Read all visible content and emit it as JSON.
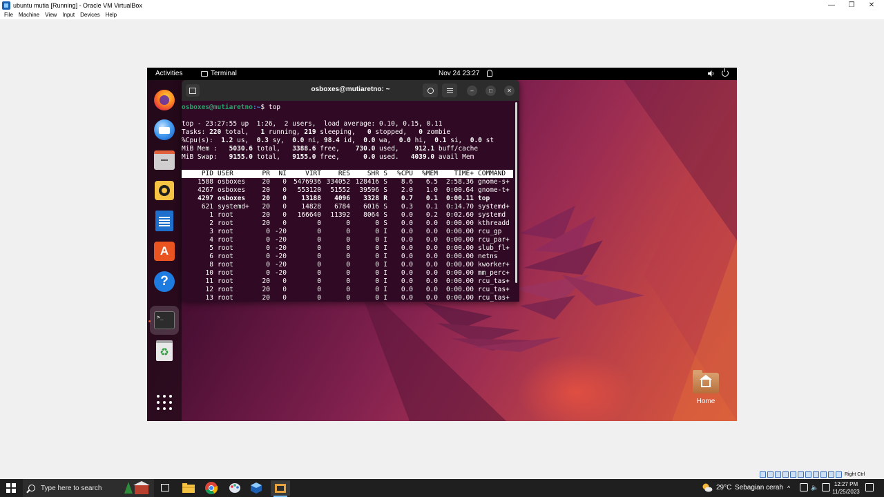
{
  "vbox": {
    "title": "ubuntu mutia [Running] - Oracle VM VirtualBox",
    "menu": [
      "File",
      "Machine",
      "View",
      "Input",
      "Devices",
      "Help"
    ],
    "controls": {
      "minimize": "—",
      "maximize": "❐",
      "close": "✕"
    },
    "host_key": "Right Ctrl"
  },
  "gnome": {
    "activities": "Activities",
    "active_app": "Terminal",
    "clock": "Nov 24  23:27",
    "home_label": "Home"
  },
  "dock": {
    "items": [
      "firefox-icon",
      "thunderbird-icon",
      "files-icon",
      "rhythmbox-icon",
      "libreoffice-writer-icon",
      "ubuntu-software-icon",
      "help-icon",
      "terminal-icon",
      "trash-icon",
      "show-apps-icon"
    ],
    "software_glyph": "A",
    "help_glyph": "?",
    "terminal_glyph": ">_",
    "trash_glyph": "♻"
  },
  "terminal": {
    "title": "osboxes@mutiaretno: ~",
    "prompt_user": "osboxes@mutiaretno",
    "prompt_path": ":~",
    "prompt_cmd": "$ top",
    "close_glyph": "✕",
    "min_glyph": "–",
    "max_glyph": "□",
    "top": {
      "uptime": "top - 23:27:55 up  1:26,  2 users,  load average: 0.10, 0.15, 0.11",
      "tasks": {
        "label": "Tasks:",
        "total": "220",
        "running": "1",
        "sleeping": "219",
        "stopped": "0",
        "zombie": "0"
      },
      "cpu": {
        "label": "%Cpu(s):",
        "us": "1.2",
        "sy": "0.3",
        "ni": "0.0",
        "id": "98.4",
        "wa": "0.0",
        "hi": "0.0",
        "si": "0.1",
        "st": "0.0"
      },
      "mem": {
        "label": "MiB Mem :",
        "total": "5030.6",
        "free": "3388.6",
        "used": "730.0",
        "buff_cache": "912.1"
      },
      "swap": {
        "label": "MiB Swap:",
        "total": "9155.0",
        "free": "9155.0",
        "used": "0.0",
        "avail": "4039.0"
      },
      "headers": [
        "PID",
        "USER",
        "PR",
        "NI",
        "VIRT",
        "RES",
        "SHR",
        "S",
        "%CPU",
        "%MEM",
        "TIME+",
        "COMMAND"
      ],
      "rows": [
        [
          "1588",
          "osboxes",
          "20",
          "0",
          "5476936",
          "334052",
          "128416",
          "S",
          "8.6",
          "6.5",
          "2:58.36",
          "gnome-s+"
        ],
        [
          "4267",
          "osboxes",
          "20",
          "0",
          "553120",
          "51552",
          "39596",
          "S",
          "2.0",
          "1.0",
          "0:00.64",
          "gnome-t+"
        ],
        [
          "4297",
          "osboxes",
          "20",
          "0",
          "13188",
          "4096",
          "3328",
          "R",
          "0.7",
          "0.1",
          "0:00.11",
          "top"
        ],
        [
          "621",
          "systemd+",
          "20",
          "0",
          "14828",
          "6784",
          "6016",
          "S",
          "0.3",
          "0.1",
          "0:14.70",
          "systemd+"
        ],
        [
          "1",
          "root",
          "20",
          "0",
          "166640",
          "11392",
          "8064",
          "S",
          "0.0",
          "0.2",
          "0:02.60",
          "systemd"
        ],
        [
          "2",
          "root",
          "20",
          "0",
          "0",
          "0",
          "0",
          "S",
          "0.0",
          "0.0",
          "0:00.00",
          "kthreadd"
        ],
        [
          "3",
          "root",
          "0",
          "-20",
          "0",
          "0",
          "0",
          "I",
          "0.0",
          "0.0",
          "0:00.00",
          "rcu_gp"
        ],
        [
          "4",
          "root",
          "0",
          "-20",
          "0",
          "0",
          "0",
          "I",
          "0.0",
          "0.0",
          "0:00.00",
          "rcu_par+"
        ],
        [
          "5",
          "root",
          "0",
          "-20",
          "0",
          "0",
          "0",
          "I",
          "0.0",
          "0.0",
          "0:00.00",
          "slub_fl+"
        ],
        [
          "6",
          "root",
          "0",
          "-20",
          "0",
          "0",
          "0",
          "I",
          "0.0",
          "0.0",
          "0:00.00",
          "netns"
        ],
        [
          "8",
          "root",
          "0",
          "-20",
          "0",
          "0",
          "0",
          "I",
          "0.0",
          "0.0",
          "0:00.00",
          "kworker+"
        ],
        [
          "10",
          "root",
          "0",
          "-20",
          "0",
          "0",
          "0",
          "I",
          "0.0",
          "0.0",
          "0:00.00",
          "mm_perc+"
        ],
        [
          "11",
          "root",
          "20",
          "0",
          "0",
          "0",
          "0",
          "I",
          "0.0",
          "0.0",
          "0:00.00",
          "rcu_tas+"
        ],
        [
          "12",
          "root",
          "20",
          "0",
          "0",
          "0",
          "0",
          "I",
          "0.0",
          "0.0",
          "0:00.00",
          "rcu_tas+"
        ],
        [
          "13",
          "root",
          "20",
          "0",
          "0",
          "0",
          "0",
          "I",
          "0.0",
          "0.0",
          "0:00.00",
          "rcu_tas+"
        ]
      ]
    }
  },
  "taskbar": {
    "search_placeholder": "Type here to search",
    "weather_temp": "29°C",
    "weather_desc": "Sebagian cerah",
    "time": "12:27 PM",
    "date": "11/25/2023",
    "tray_chevron": "^",
    "volume_glyph": "🔈"
  },
  "colors": {
    "terminal_bg": "#300a24",
    "prompt_user": "#26a269",
    "prompt_path": "#4b88dc",
    "ubuntu_orange": "#e95420",
    "taskbar": "#1f1f1f"
  }
}
